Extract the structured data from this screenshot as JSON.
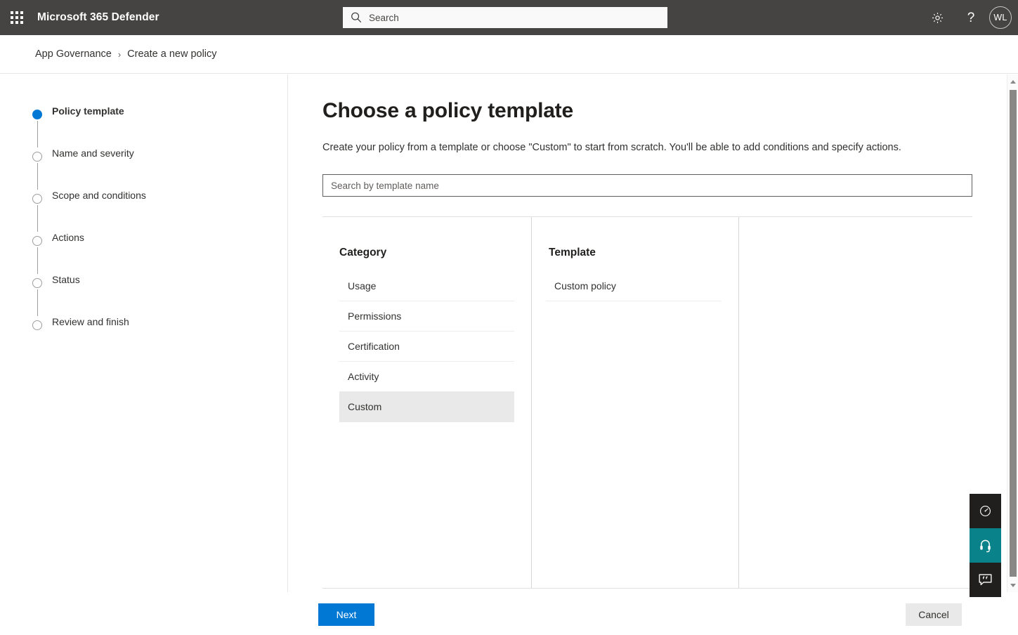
{
  "suite": {
    "waffle_label": "app-launcher",
    "title": "Microsoft 365 Defender",
    "search_placeholder": "Search",
    "search_value": "",
    "settings_label": "Settings",
    "help_label": "?",
    "avatar_initials": "WL"
  },
  "breadcrumb": {
    "items": [
      {
        "label": "App Governance"
      },
      {
        "label": "Create a new policy"
      }
    ],
    "separator": "›"
  },
  "wizard": {
    "steps": [
      {
        "label": "Policy template",
        "state": "current"
      },
      {
        "label": "Name and severity",
        "state": "pending"
      },
      {
        "label": "Scope and conditions",
        "state": "pending"
      },
      {
        "label": "Actions",
        "state": "pending"
      },
      {
        "label": "Status",
        "state": "pending"
      },
      {
        "label": "Review and finish",
        "state": "pending"
      }
    ]
  },
  "main": {
    "title": "Choose a policy template",
    "description": "Create your policy from a template or choose \"Custom\" to start from scratch. You'll be able to add conditions and specify actions.",
    "search_placeholder": "Search by template name",
    "search_value": "",
    "category": {
      "heading": "Category",
      "options": [
        {
          "label": "Usage",
          "selected": false
        },
        {
          "label": "Permissions",
          "selected": false
        },
        {
          "label": "Certification",
          "selected": false
        },
        {
          "label": "Activity",
          "selected": false
        },
        {
          "label": "Custom",
          "selected": true
        }
      ]
    },
    "template": {
      "heading": "Template",
      "options": [
        {
          "label": "Custom policy",
          "selected": false
        }
      ]
    }
  },
  "footer": {
    "next_label": "Next",
    "cancel_label": "Cancel"
  },
  "widgets": [
    {
      "name": "performance-gauge",
      "theme": "dark"
    },
    {
      "name": "support-headset",
      "theme": "teal"
    },
    {
      "name": "feedback-chat",
      "theme": "dark"
    }
  ],
  "colors": {
    "suite_bar": "#464442",
    "accent": "#0078d4",
    "selected_row": "#e9e9e9",
    "widget_teal": "#0a8289",
    "widget_dark": "#201f1e"
  }
}
